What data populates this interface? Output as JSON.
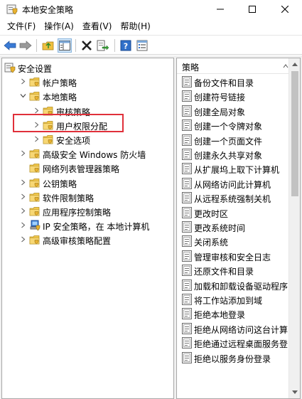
{
  "window": {
    "title": "本地安全策略",
    "accent_color": "#ffffff"
  },
  "menu": [
    {
      "label": "文件(F)"
    },
    {
      "label": "操作(A)"
    },
    {
      "label": "查看(V)"
    },
    {
      "label": "帮助(H)"
    }
  ],
  "toolbar": {
    "icons": [
      "back-arrow-icon",
      "forward-arrow-icon",
      "up-folder-icon",
      "show-hide-tree-icon",
      "delete-icon",
      "export-list-icon",
      "help-icon",
      "properties-icon"
    ]
  },
  "tree": {
    "items": [
      {
        "label": "安全设置",
        "level": 0,
        "expander": "none",
        "icon": "security-root-icon"
      },
      {
        "label": "帐户策略",
        "level": 1,
        "expander": "collapsed",
        "icon": "folder-icon"
      },
      {
        "label": "本地策略",
        "level": 1,
        "expander": "expanded",
        "icon": "folder-icon"
      },
      {
        "label": "审核策略",
        "level": 2,
        "expander": "collapsed",
        "icon": "folder-icon"
      },
      {
        "label": "用户权限分配",
        "level": 2,
        "expander": "collapsed",
        "icon": "folder-icon",
        "highlighted": true
      },
      {
        "label": "安全选项",
        "level": 2,
        "expander": "collapsed",
        "icon": "folder-icon"
      },
      {
        "label": "高级安全 Windows 防火墙",
        "level": 1,
        "expander": "collapsed",
        "icon": "folder-icon"
      },
      {
        "label": "网络列表管理器策略",
        "level": 1,
        "expander": "none",
        "icon": "folder-icon"
      },
      {
        "label": "公钥策略",
        "level": 1,
        "expander": "collapsed",
        "icon": "folder-icon"
      },
      {
        "label": "软件限制策略",
        "level": 1,
        "expander": "collapsed",
        "icon": "folder-icon"
      },
      {
        "label": "应用程序控制策略",
        "level": 1,
        "expander": "collapsed",
        "icon": "folder-icon"
      },
      {
        "label": "IP 安全策略，在 本地计算机",
        "level": 1,
        "expander": "collapsed",
        "icon": "ip-security-icon"
      },
      {
        "label": "高级审核策略配置",
        "level": 1,
        "expander": "collapsed",
        "icon": "folder-icon"
      }
    ],
    "highlight_color": "#e0303a"
  },
  "policy_list": {
    "header": "策略",
    "items": [
      "备份文件和目录",
      "创建符号链接",
      "创建全局对象",
      "创建一个令牌对象",
      "创建一个页面文件",
      "创建永久共享对象",
      "从扩展坞上取下计算机",
      "从网络访问此计算机",
      "从远程系统强制关机",
      "更改时区",
      "更改系统时间",
      "关闭系统",
      "管理审核和安全日志",
      "还原文件和目录",
      "加载和卸载设备驱动程序",
      "将工作站添加到域",
      "拒绝本地登录",
      "拒绝从网络访问这台计算",
      "拒绝通过远程桌面服务登",
      "拒绝以服务身份登录"
    ]
  }
}
